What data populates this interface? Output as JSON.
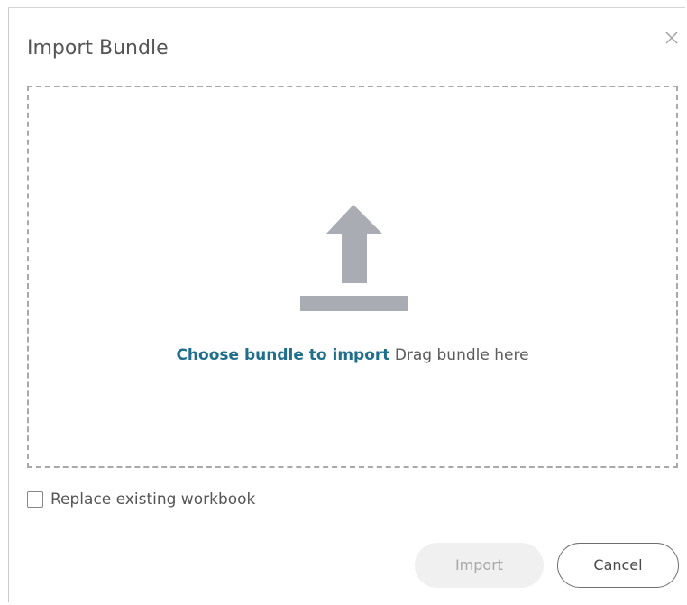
{
  "dialog": {
    "title": "Import Bundle",
    "close_icon": "close-icon"
  },
  "dropzone": {
    "icon": "upload-icon",
    "choose_link": "Choose bundle to import",
    "drag_hint": "Drag bundle here"
  },
  "options": {
    "replace_label": "Replace existing workbook",
    "replace_checked": false
  },
  "footer": {
    "import_label": "Import",
    "import_enabled": false,
    "cancel_label": "Cancel"
  },
  "colors": {
    "link": "#1f6e8c",
    "icon": "#a9adb3",
    "text": "#555555",
    "disabled_button_bg": "#f0f0f0"
  }
}
